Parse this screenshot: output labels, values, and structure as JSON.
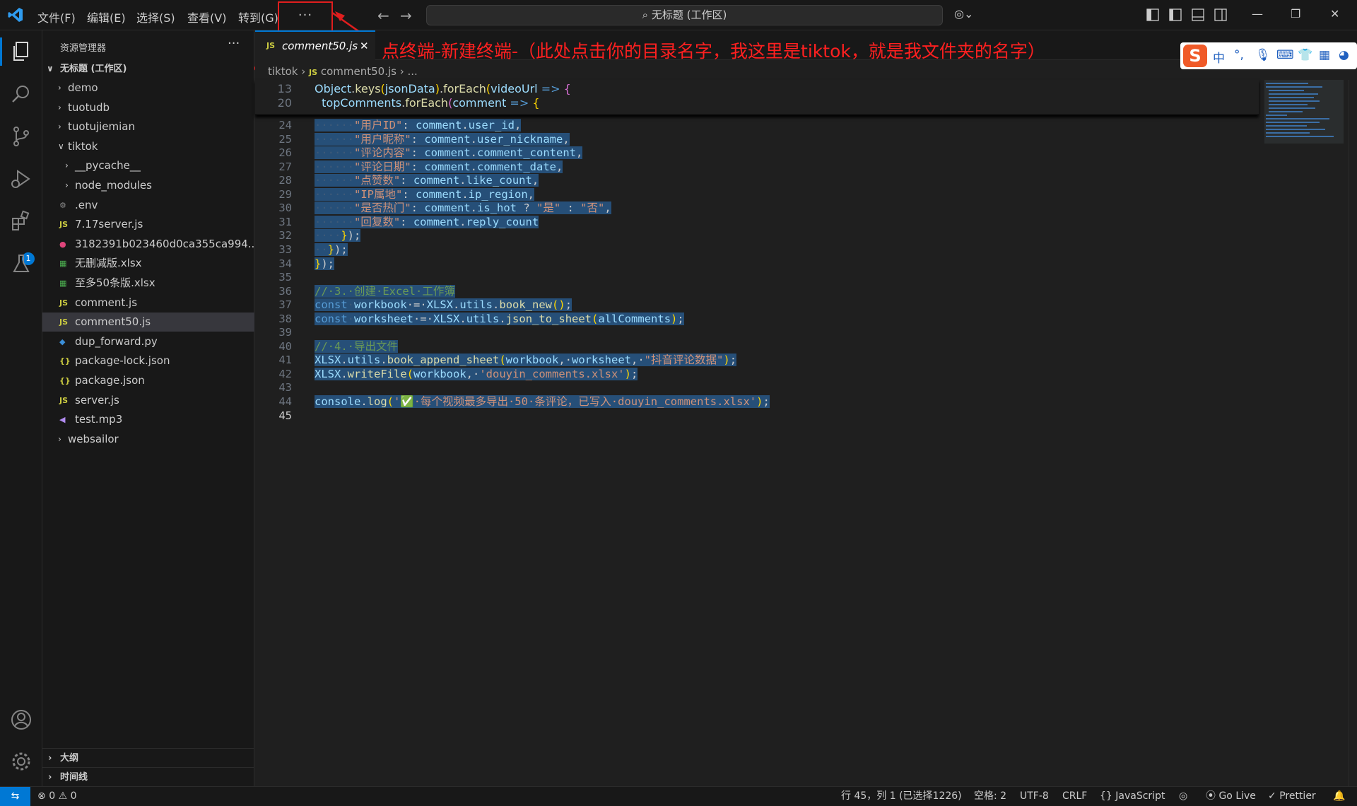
{
  "menu": {
    "file": "文件(F)",
    "edit": "编辑(E)",
    "selection": "选择(S)",
    "view": "查看(V)",
    "goto": "转到(G)",
    "more": "···"
  },
  "search": {
    "label": "无标题 (工作区)"
  },
  "explorer": {
    "title": "资源管理器",
    "workspace": "无标题 (工作区)",
    "items": [
      {
        "label": "demo",
        "kind": "folder",
        "depth": 1
      },
      {
        "label": "tuotudb",
        "kind": "folder",
        "depth": 1
      },
      {
        "label": "tuotujiemian",
        "kind": "folder",
        "depth": 1
      },
      {
        "label": "tiktok",
        "kind": "folder-open",
        "depth": 1
      },
      {
        "label": "__pycache__",
        "kind": "folder",
        "depth": 2
      },
      {
        "label": "node_modules",
        "kind": "folder",
        "depth": 2
      },
      {
        "label": ".env",
        "kind": "gear",
        "depth": 2
      },
      {
        "label": "7.17server.js",
        "kind": "js",
        "depth": 2
      },
      {
        "label": "3182391b023460d0ca355ca994...",
        "kind": "media",
        "depth": 2
      },
      {
        "label": "无删减版.xlsx",
        "kind": "xlsx",
        "depth": 2
      },
      {
        "label": "至多50条版.xlsx",
        "kind": "xlsx",
        "depth": 2
      },
      {
        "label": "comment.js",
        "kind": "js",
        "depth": 2
      },
      {
        "label": "comment50.js",
        "kind": "js",
        "depth": 2,
        "active": true
      },
      {
        "label": "dup_forward.py",
        "kind": "py",
        "depth": 2
      },
      {
        "label": "package-lock.json",
        "kind": "json",
        "depth": 2
      },
      {
        "label": "package.json",
        "kind": "json",
        "depth": 2
      },
      {
        "label": "server.js",
        "kind": "js",
        "depth": 2
      },
      {
        "label": "test.mp3",
        "kind": "audio",
        "depth": 2
      },
      {
        "label": "websailor",
        "kind": "folder",
        "depth": 1
      }
    ],
    "outline": "大纲",
    "timeline": "时间线"
  },
  "tab": {
    "name": "comment50.js",
    "icon": "JS"
  },
  "breadcrumb": {
    "folder": "tiktok",
    "file": "comment50.js",
    "rest": "..."
  },
  "annotation": {
    "text": "点终端-新建终端-（此处点击你的目录名字，我这里是tiktok，就是我文件夹的名字）"
  },
  "ime": {
    "zh": "中",
    "punct": "°,"
  },
  "sticky": [
    {
      "num": "13",
      "html": "<span class=\"v\">Object</span><span class=\"w\">.</span><span class=\"f\">keys</span><span class=\"b\">(</span><span class=\"v\">jsonData</span><span class=\"b\">)</span><span class=\"w\">.</span><span class=\"f\">forEach</span><span class=\"b\">(</span><span class=\"v\">videoUrl</span><span class=\"k\"> =&gt; </span><span class=\"p\">{</span>"
    },
    {
      "num": "20",
      "html": "  <span class=\"v\">topComments</span><span class=\"w\">.</span><span class=\"f\">forEach</span><span class=\"p\">(</span><span class=\"v\">comment</span><span class=\"k\"> =&gt; </span><span class=\"b\">{</span>"
    }
  ],
  "lines": [
    {
      "num": "24",
      "html": "<span class=\"sel\"><span class=\"ws\">······</span><span class=\"s\">\"用户ID\"</span><span class=\"w\">: </span><span class=\"v\">comment</span><span class=\"w\">.</span><span class=\"v\">user_id</span><span class=\"w\">,</span></span>"
    },
    {
      "num": "25",
      "html": "<span class=\"sel\"><span class=\"ws\">······</span><span class=\"s\">\"用户昵称\"</span><span class=\"w\">: </span><span class=\"v\">comment</span><span class=\"w\">.</span><span class=\"v\">user_nickname</span><span class=\"w\">,</span></span>"
    },
    {
      "num": "26",
      "html": "<span class=\"sel\"><span class=\"ws\">······</span><span class=\"s\">\"评论内容\"</span><span class=\"w\">: </span><span class=\"v\">comment</span><span class=\"w\">.</span><span class=\"v\">comment_content</span><span class=\"w\">,</span></span>"
    },
    {
      "num": "27",
      "html": "<span class=\"sel\"><span class=\"ws\">······</span><span class=\"s\">\"评论日期\"</span><span class=\"w\">: </span><span class=\"v\">comment</span><span class=\"w\">.</span><span class=\"v\">comment_date</span><span class=\"w\">,</span></span>"
    },
    {
      "num": "28",
      "html": "<span class=\"sel\"><span class=\"ws\">······</span><span class=\"s\">\"点赞数\"</span><span class=\"w\">: </span><span class=\"v\">comment</span><span class=\"w\">.</span><span class=\"v\">like_count</span><span class=\"w\">,</span></span>"
    },
    {
      "num": "29",
      "html": "<span class=\"sel\"><span class=\"ws\">······</span><span class=\"s\">\"IP属地\"</span><span class=\"w\">: </span><span class=\"v\">comment</span><span class=\"w\">.</span><span class=\"v\">ip_region</span><span class=\"w\">,</span></span>"
    },
    {
      "num": "30",
      "html": "<span class=\"sel\"><span class=\"ws\">······</span><span class=\"s\">\"是否热门\"</span><span class=\"w\">: </span><span class=\"v\">comment</span><span class=\"w\">.</span><span class=\"v\">is_hot</span><span class=\"w\"> ? </span><span class=\"s\">\"是\"</span><span class=\"w\"> : </span><span class=\"s\">\"否\"</span><span class=\"w\">,</span></span>"
    },
    {
      "num": "31",
      "html": "<span class=\"sel\"><span class=\"ws\">······</span><span class=\"s\">\"回复数\"</span><span class=\"w\">: </span><span class=\"v\">comment</span><span class=\"w\">.</span><span class=\"v\">reply_count</span></span>"
    },
    {
      "num": "32",
      "html": "<span class=\"sel\"><span class=\"ws\">····</span><span class=\"b\">}</span><span class=\"w\">);</span></span>"
    },
    {
      "num": "33",
      "html": "<span class=\"sel\"><span class=\"ws\">··</span><span class=\"b\">}</span><span class=\"w\">);</span></span>"
    },
    {
      "num": "34",
      "html": "<span class=\"sel\"><span class=\"b\">}</span><span class=\"w\">);</span></span>"
    },
    {
      "num": "35",
      "html": ""
    },
    {
      "num": "36",
      "html": "<span class=\"sel\"><span class=\"c\">//·3.·创建·Excel·工作簿</span></span>"
    },
    {
      "num": "37",
      "html": "<span class=\"sel\"><span class=\"k\">const</span><span class=\"ws\">·</span><span class=\"v\">workbook</span><span class=\"w\">·=·</span><span class=\"v\">XLSX</span><span class=\"w\">.</span><span class=\"v\">utils</span><span class=\"w\">.</span><span class=\"f\">book_new</span><span class=\"b\">()</span><span class=\"w\">;</span></span>"
    },
    {
      "num": "38",
      "html": "<span class=\"sel\"><span class=\"k\">const</span><span class=\"ws\">·</span><span class=\"v\">worksheet</span><span class=\"w\">·=·</span><span class=\"v\">XLSX</span><span class=\"w\">.</span><span class=\"v\">utils</span><span class=\"w\">.</span><span class=\"f\">json_to_sheet</span><span class=\"b\">(</span><span class=\"v\">allComments</span><span class=\"b\">)</span><span class=\"w\">;</span></span>"
    },
    {
      "num": "39",
      "html": ""
    },
    {
      "num": "40",
      "html": "<span class=\"sel\"><span class=\"c\">//·4.·导出文件</span></span>"
    },
    {
      "num": "41",
      "html": "<span class=\"sel\"><span class=\"v\">XLSX</span><span class=\"w\">.</span><span class=\"v\">utils</span><span class=\"w\">.</span><span class=\"f\">book_append_sheet</span><span class=\"b\">(</span><span class=\"v\">workbook</span><span class=\"w\">,·</span><span class=\"v\">worksheet</span><span class=\"w\">,·</span><span class=\"s\">\"抖音评论数据\"</span><span class=\"b\">)</span><span class=\"w\">;</span></span>"
    },
    {
      "num": "42",
      "html": "<span class=\"sel\"><span class=\"v\">XLSX</span><span class=\"w\">.</span><span class=\"f\">writeFile</span><span class=\"b\">(</span><span class=\"v\">workbook</span><span class=\"w\">,·</span><span class=\"s\">'douyin_comments.xlsx'</span><span class=\"b\">)</span><span class=\"w\">;</span></span>"
    },
    {
      "num": "43",
      "html": ""
    },
    {
      "num": "44",
      "html": "<span class=\"sel\"><span class=\"v\">console</span><span class=\"w\">.</span><span class=\"f\">log</span><span class=\"b\">(</span><span class=\"s\">'✅·每个视频最多导出·50·条评论，已写入·douyin_comments.xlsx'</span><span class=\"b\">)</span><span class=\"w\">;</span></span>"
    },
    {
      "num": "45",
      "html": "",
      "current": true
    }
  ],
  "status": {
    "remote": "⇆",
    "errors": "0",
    "warnings": "0",
    "position": "行 45，列 1 (已选择1226)",
    "spaces": "空格: 2",
    "encoding": "UTF-8",
    "eol": "CRLF",
    "language": "{} JavaScript",
    "golive": "Go Live",
    "prettier": "Prettier"
  },
  "colors": {
    "accent": "#0078d4",
    "selection": "#264f78",
    "annotation": "#ff2020"
  }
}
